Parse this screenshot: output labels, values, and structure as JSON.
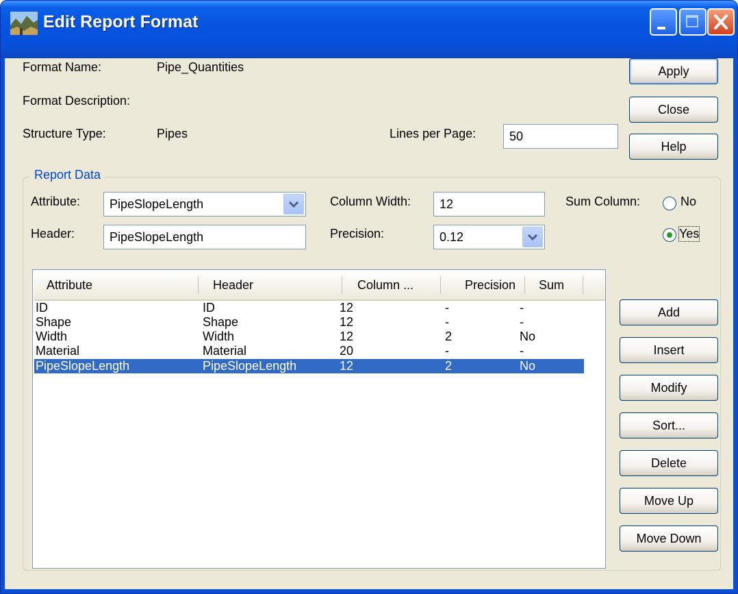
{
  "window": {
    "title": "Edit Report Format",
    "icon": "terrain-app-icon"
  },
  "format": {
    "name_label": "Format Name:",
    "name_value": "Pipe_Quantities",
    "description_label": "Format Description:",
    "structure_label": "Structure Type:",
    "structure_value": "Pipes",
    "lines_label": "Lines per Page:",
    "lines_value": "50"
  },
  "side_buttons": {
    "apply": "Apply",
    "close": "Close",
    "help": "Help"
  },
  "report_data": {
    "group_title": "Report Data",
    "attribute_label": "Attribute:",
    "attribute_value": "PipeSlopeLength",
    "header_label": "Header:",
    "header_value": "PipeSlopeLength",
    "column_width_label": "Column Width:",
    "column_width_value": "12",
    "precision_label": "Precision:",
    "precision_value": "0.12",
    "sum_label": "Sum Column:",
    "sum_no": "No",
    "sum_yes": "Yes",
    "sum_selected": "Yes"
  },
  "table": {
    "columns": [
      "Attribute",
      "Header",
      "Column ...",
      "Precision",
      "Sum"
    ],
    "rows": [
      [
        "ID",
        "ID",
        "12",
        "-",
        "-"
      ],
      [
        "Shape",
        "Shape",
        "12",
        "-",
        "-"
      ],
      [
        "Width",
        "Width",
        "12",
        "2",
        "No"
      ],
      [
        "Material",
        "Material",
        "20",
        "-",
        "-"
      ],
      [
        "PipeSlopeLength",
        "PipeSlopeLength",
        "12",
        "2",
        "No"
      ]
    ],
    "selected_row": 4
  },
  "action_buttons": {
    "add": "Add",
    "insert": "Insert",
    "modify": "Modify",
    "sort": "Sort...",
    "delete": "Delete",
    "move_up": "Move Up",
    "move_down": "Move Down"
  },
  "colors": {
    "titlebar": "#0553e0",
    "selection": "#316ac5",
    "dialog_bg": "#ece9d8",
    "group_title": "#0046d5"
  }
}
